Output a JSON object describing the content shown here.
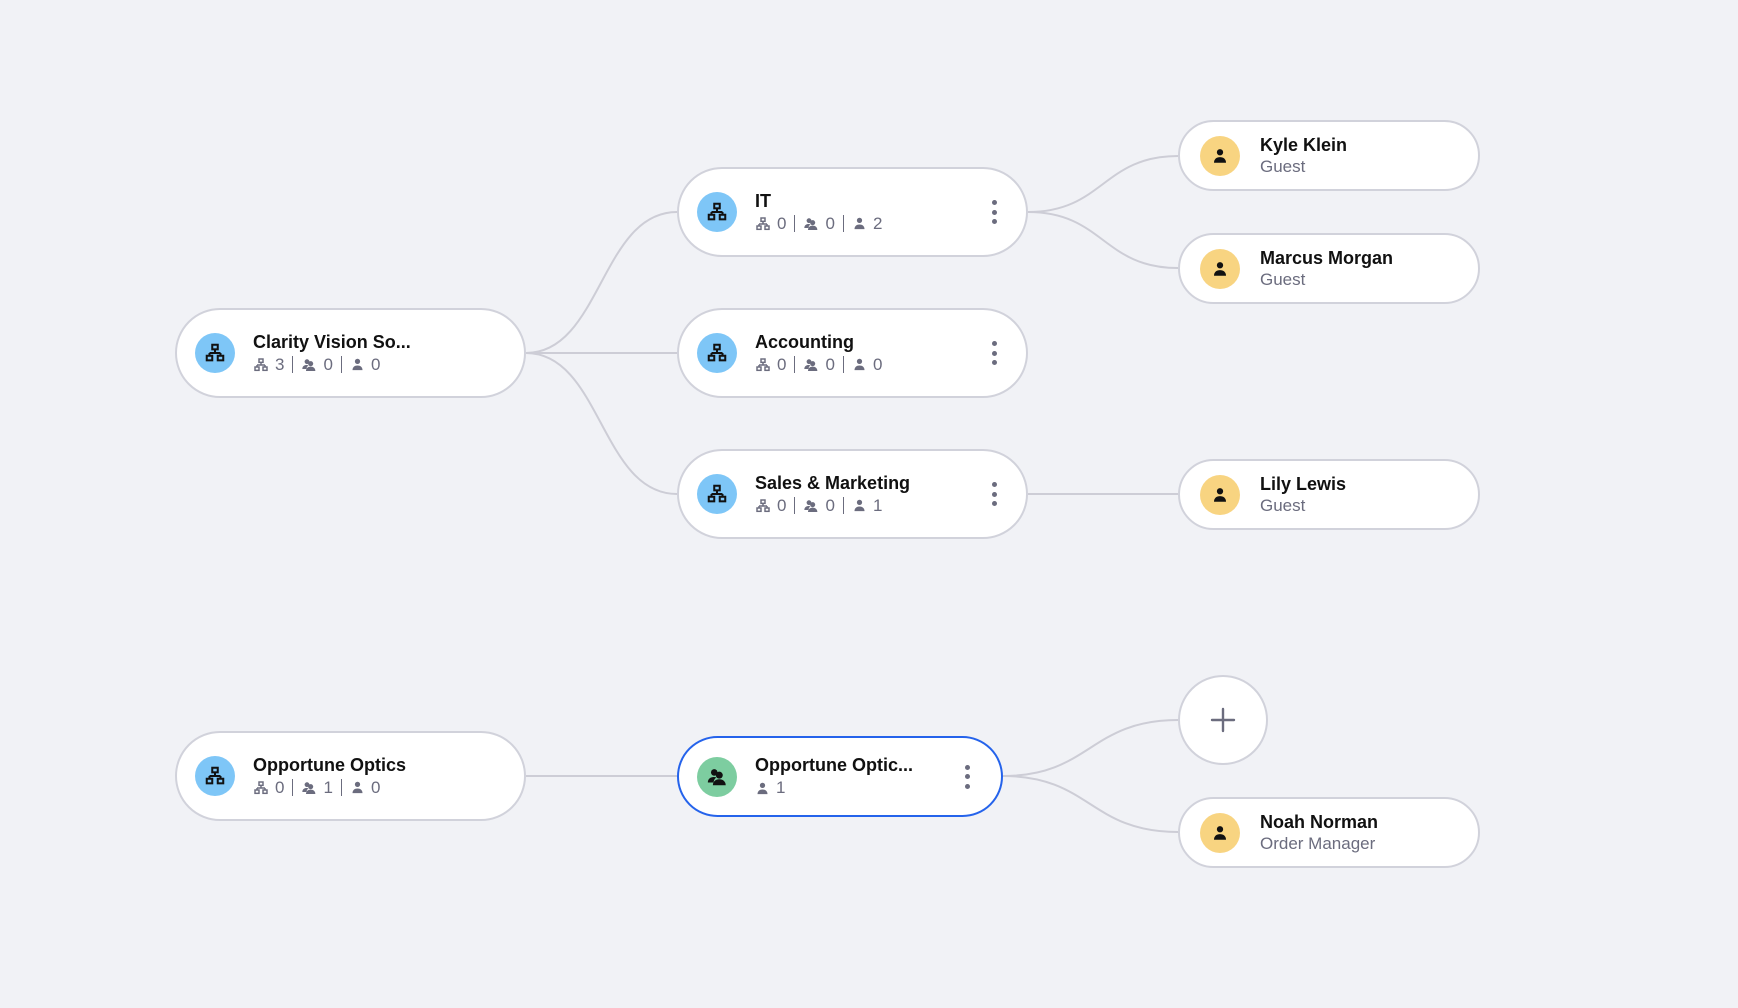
{
  "colors": {
    "background": "#f1f2f6",
    "org_avatar": "#7ec6f7",
    "team_avatar": "#7dcda0",
    "user_avatar": "#f8d481",
    "selected_border": "#2563eb",
    "connector": "#cdcdd6"
  },
  "trees": [
    {
      "root": {
        "type": "organization",
        "icon": "organization-icon",
        "name": "Clarity Vision So...",
        "suborgs": "3",
        "teams": "0",
        "users": "0"
      },
      "children": [
        {
          "type": "organization",
          "icon": "organization-icon",
          "name": "IT",
          "suborgs": "0",
          "teams": "0",
          "users": "2",
          "has_menu": true,
          "children": [
            {
              "type": "user",
              "icon": "user-icon",
              "name": "Kyle Klein",
              "role": "Guest"
            },
            {
              "type": "user",
              "icon": "user-icon",
              "name": "Marcus Morgan",
              "role": "Guest"
            }
          ]
        },
        {
          "type": "organization",
          "icon": "organization-icon",
          "name": "Accounting",
          "suborgs": "0",
          "teams": "0",
          "users": "0",
          "has_menu": true,
          "children": []
        },
        {
          "type": "organization",
          "icon": "organization-icon",
          "name": "Sales & Marketing",
          "suborgs": "0",
          "teams": "0",
          "users": "1",
          "has_menu": true,
          "children": [
            {
              "type": "user",
              "icon": "user-icon",
              "name": "Lily Lewis",
              "role": "Guest"
            }
          ]
        }
      ]
    },
    {
      "root": {
        "type": "organization",
        "icon": "organization-icon",
        "name": "Opportune Optics",
        "suborgs": "0",
        "teams": "1",
        "users": "0"
      },
      "children": [
        {
          "type": "team",
          "icon": "team-icon",
          "name": "Opportune Optic...",
          "users": "1",
          "has_menu": true,
          "selected": true,
          "add_button_label": "+",
          "children": [
            {
              "type": "user",
              "icon": "user-icon",
              "name": "Noah Norman",
              "role": "Order Manager"
            }
          ]
        }
      ]
    }
  ]
}
